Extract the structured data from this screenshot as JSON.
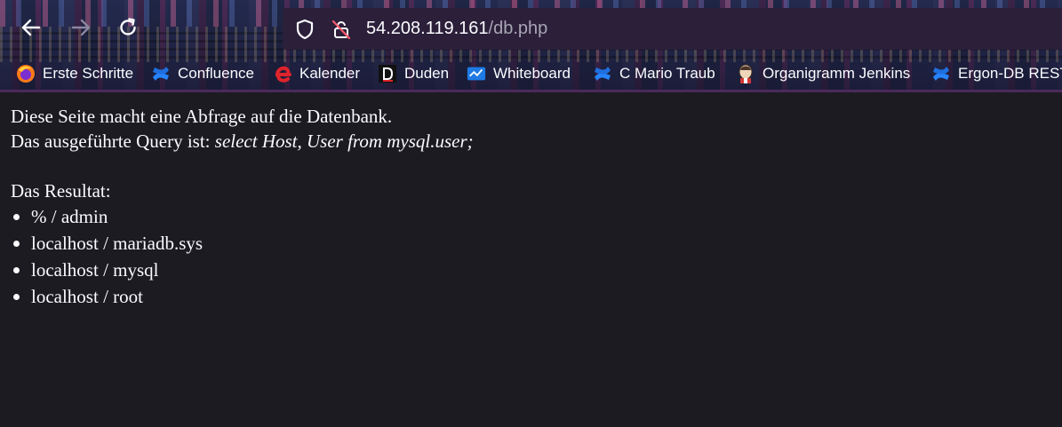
{
  "browser": {
    "url_host": "54.208.119.161",
    "url_path": "/db.php",
    "bookmarks": [
      {
        "label": "Erste Schritte",
        "icon": "firefox-icon"
      },
      {
        "label": "Confluence",
        "icon": "confluence-icon"
      },
      {
        "label": "Kalender",
        "icon": "e-icon"
      },
      {
        "label": "Duden",
        "icon": "duden-icon"
      },
      {
        "label": "Whiteboard",
        "icon": "whiteboard-icon"
      },
      {
        "label": "C Mario Traub",
        "icon": "confluence-icon"
      },
      {
        "label": "Organigramm Jenkins",
        "icon": "jenkins-icon"
      },
      {
        "label": "Ergon-DB REST",
        "icon": "confluence-icon"
      }
    ]
  },
  "page": {
    "line1": "Diese Seite macht eine Abfrage auf die Datenbank.",
    "line2_prefix": "Das ausgeführte Query ist: ",
    "query": "select Host, User from mysql.user;",
    "result_heading": "Das Resultat:",
    "results": [
      "% / admin",
      "localhost / mariadb.sys",
      "localhost / mysql",
      "localhost / root"
    ]
  },
  "colors": {
    "page_bg": "#1c1b22",
    "text": "#fbfbfe",
    "url_path": "#a8a6b4",
    "confluence_blue": "#1f6fe0",
    "kalender_red": "#e0242b"
  }
}
